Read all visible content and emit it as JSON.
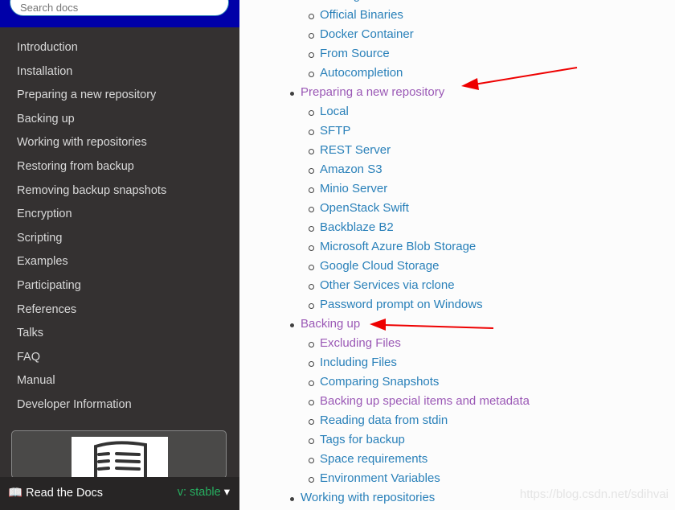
{
  "search": {
    "placeholder": "Search docs"
  },
  "sidebar": {
    "items": [
      "Introduction",
      "Installation",
      "Preparing a new repository",
      "Backing up",
      "Working with repositories",
      "Restoring from backup",
      "Removing backup snapshots",
      "Encryption",
      "Scripting",
      "Examples",
      "Participating",
      "References",
      "Talks",
      "FAQ",
      "Manual",
      "Developer Information"
    ]
  },
  "footer": {
    "rtd_label": "Read the Docs",
    "version": "v: stable"
  },
  "colors": {
    "link": "#2980b9",
    "visited": "#9b59b6",
    "version": "#27ae60",
    "search_band": "#0000a8"
  },
  "toc": [
    {
      "text": "Packages",
      "level": 2,
      "visited": false
    },
    {
      "text": "Official Binaries",
      "level": 2,
      "visited": false
    },
    {
      "text": "Docker Container",
      "level": 2,
      "visited": false
    },
    {
      "text": "From Source",
      "level": 2,
      "visited": false
    },
    {
      "text": "Autocompletion",
      "level": 2,
      "visited": false
    },
    {
      "text": "Preparing a new repository",
      "level": 1,
      "visited": true
    },
    {
      "text": "Local",
      "level": 2,
      "visited": false
    },
    {
      "text": "SFTP",
      "level": 2,
      "visited": false
    },
    {
      "text": "REST Server",
      "level": 2,
      "visited": false
    },
    {
      "text": "Amazon S3",
      "level": 2,
      "visited": false
    },
    {
      "text": "Minio Server",
      "level": 2,
      "visited": false
    },
    {
      "text": "OpenStack Swift",
      "level": 2,
      "visited": false
    },
    {
      "text": "Backblaze B2",
      "level": 2,
      "visited": false
    },
    {
      "text": "Microsoft Azure Blob Storage",
      "level": 2,
      "visited": false
    },
    {
      "text": "Google Cloud Storage",
      "level": 2,
      "visited": false
    },
    {
      "text": "Other Services via rclone",
      "level": 2,
      "visited": false
    },
    {
      "text": "Password prompt on Windows",
      "level": 2,
      "visited": false
    },
    {
      "text": "Backing up",
      "level": 1,
      "visited": true
    },
    {
      "text": "Excluding Files",
      "level": 2,
      "visited": true
    },
    {
      "text": "Including Files",
      "level": 2,
      "visited": false
    },
    {
      "text": "Comparing Snapshots",
      "level": 2,
      "visited": false
    },
    {
      "text": "Backing up special items and metadata",
      "level": 2,
      "visited": true
    },
    {
      "text": "Reading data from stdin",
      "level": 2,
      "visited": false
    },
    {
      "text": "Tags for backup",
      "level": 2,
      "visited": false
    },
    {
      "text": "Space requirements",
      "level": 2,
      "visited": false
    },
    {
      "text": "Environment Variables",
      "level": 2,
      "visited": false
    },
    {
      "text": "Working with repositories",
      "level": 1,
      "visited": false
    }
  ],
  "watermark": "https://blog.csdn.net/sdihvai"
}
